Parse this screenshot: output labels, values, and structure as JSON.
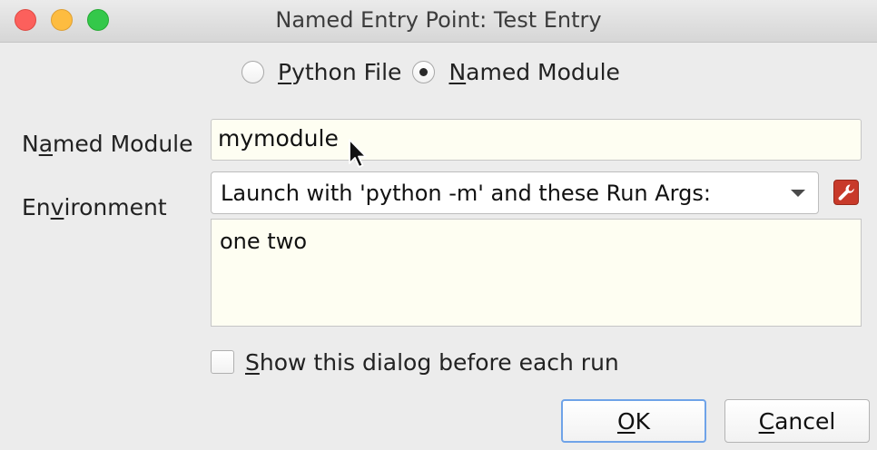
{
  "window": {
    "title": "Named Entry Point: Test Entry"
  },
  "mode": {
    "options": [
      {
        "pre": "",
        "mnemonic": "P",
        "post": "ython File",
        "selected": false
      },
      {
        "pre": "",
        "mnemonic": "N",
        "post": "amed Module",
        "selected": true
      }
    ]
  },
  "module_field": {
    "label_pre": "N",
    "label_mnemonic": "a",
    "label_post": "med Module",
    "value": "mymodule"
  },
  "environment": {
    "label_pre": "En",
    "label_mnemonic": "v",
    "label_post": "ironment",
    "selected_option": "Launch with 'python -m' and these Run Args:",
    "run_args": "one two"
  },
  "show_dialog": {
    "label_mnemonic": "S",
    "label_post": "how this dialog before each run",
    "checked": false
  },
  "buttons": {
    "ok_mnemonic": "O",
    "ok_post": "K",
    "cancel_mnemonic": "C",
    "cancel_post": "ancel"
  },
  "icons": {
    "edit": "wrench-icon",
    "cursor": "mouse-pointer-icon"
  },
  "colors": {
    "input_bg": "#fefef2",
    "ok_border": "#6fa3e8",
    "edit_button": "#c83a2a"
  }
}
